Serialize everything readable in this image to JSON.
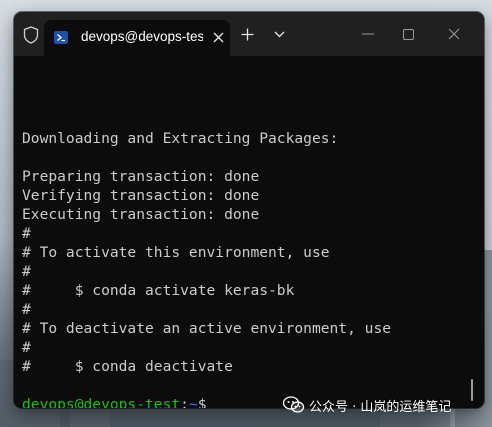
{
  "colors": {
    "titlebar_bg": "#202020",
    "terminal_bg": "#0c0c0c",
    "text": "#cccccc",
    "prompt_user": "#16c60c",
    "prompt_path": "#3b78ff"
  },
  "window": {
    "tab": {
      "icon": "powershell-icon",
      "title": "devops@devops-test"
    },
    "controls": {
      "shield_icon": "shield-icon",
      "close_tab_icon": "close-icon",
      "new_tab_icon": "plus-icon",
      "dropdown_icon": "chevron-down-icon",
      "minimize_icon": "minimize-icon",
      "maximize_icon": "maximize-icon",
      "close_window_icon": "close-icon"
    }
  },
  "terminal": {
    "lines": [
      "Downloading and Extracting Packages:",
      "",
      "Preparing transaction: done",
      "Verifying transaction: done",
      "Executing transaction: done",
      "#",
      "# To activate this environment, use",
      "#",
      "#     $ conda activate keras-bk",
      "#",
      "# To deactivate an active environment, use",
      "#",
      "#     $ conda deactivate",
      ""
    ],
    "prompt": {
      "user_host": "devops@devops-test",
      "separator": ":",
      "path": "~",
      "symbol": "$"
    }
  },
  "watermark": {
    "icon": "wechat-icon",
    "text": "公众号 · 山岚的运维笔记"
  }
}
